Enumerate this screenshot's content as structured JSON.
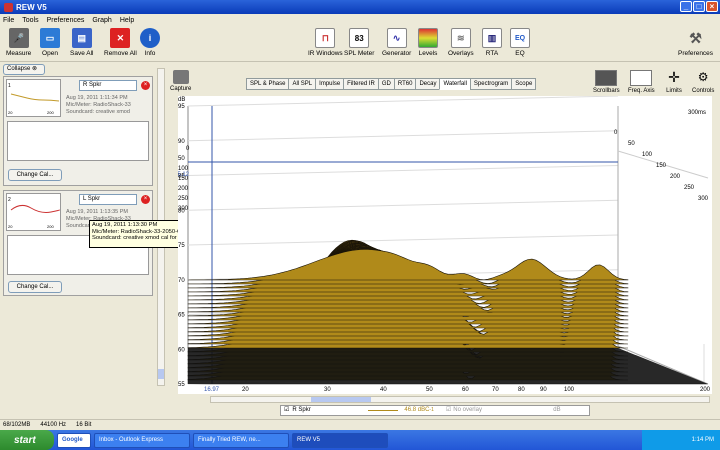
{
  "window": {
    "title": "REW V5"
  },
  "menu": [
    "File",
    "Tools",
    "Preferences",
    "Graph",
    "Help"
  ],
  "toolbar": {
    "measure": "Measure",
    "open": "Open",
    "save_all": "Save All",
    "remove_all": "Remove All",
    "info": "Info",
    "ir_windows": "IR Windows",
    "spl_meter": "SPL Meter",
    "spl_value": "83",
    "generator": "Generator",
    "levels": "Levels",
    "overlays": "Overlays",
    "rta": "RTA",
    "eq": "EQ",
    "preferences": "Preferences"
  },
  "left": {
    "collapse": "Collapse",
    "m1": {
      "name": "R Spkr",
      "date": "Aug 19, 2011 1:11:34 PM",
      "mic": "Mic/Meter: RadioShack-33",
      "sound": "Soundcard: creative xmod",
      "change": "Change Cal..."
    },
    "m2": {
      "name": "L Spkr",
      "date": "Aug 19, 2011 1:13:35 PM",
      "mic": "Mic/Meter: RadioShack-33",
      "sound": "Soundcard: creative xmod",
      "change": "Change Cal..."
    }
  },
  "tooltip": {
    "line1": "Aug 19, 2011 1:13:30 PM",
    "line2": "Mic/Meter: RadioShack-33-2050-CS.cal with inverse C",
    "line3": "Soundcard: creative xmod cal for REW.cal"
  },
  "capture": "Capture",
  "tabs": [
    "SPL & Phase",
    "All SPL",
    "Impulse",
    "Filtered IR",
    "GD",
    "RT60",
    "Decay",
    "Waterfall",
    "Spectrogram",
    "Scope"
  ],
  "active_tab": "Waterfall",
  "right_tools": {
    "scrollbars": "Scrollbars",
    "freq_axis": "Freq. Axis",
    "limits": "Limits",
    "controls": "Controls"
  },
  "chart": {
    "y_unit": "dB",
    "y_ticks": [
      "95",
      "90",
      "85",
      "80",
      "75",
      "70",
      "65",
      "60",
      "55"
    ],
    "x_ticks": [
      "20",
      "30",
      "40",
      "50",
      "60",
      "70",
      "80",
      "90",
      "100",
      "200 Hz"
    ],
    "time_ticks": [
      "0",
      "50",
      "100",
      "150",
      "200",
      "250",
      "300"
    ],
    "time_ticks_right": [
      "300ms",
      "0",
      "50",
      "100",
      "150",
      "200",
      "250",
      "300"
    ],
    "cursor_x": "16.97",
    "cursor_y": "85.12",
    "fill_color": "#b08a1a",
    "line_color": "#1a1408"
  },
  "legend": {
    "name": "R Spkr",
    "value": "46.8 dBC",
    "sup": "-1",
    "no_overlay": "No overlay",
    "dB": "dB"
  },
  "status": {
    "mem": "68/102MB",
    "rate": "44100 Hz",
    "bits": "16 Bit"
  },
  "taskbar": {
    "start": "start",
    "google": "Google",
    "t1": "Inbox - Outlook Express",
    "t2": "Finally Tried REW, ne...",
    "t3": "REW V5",
    "time": "1:14 PM"
  }
}
